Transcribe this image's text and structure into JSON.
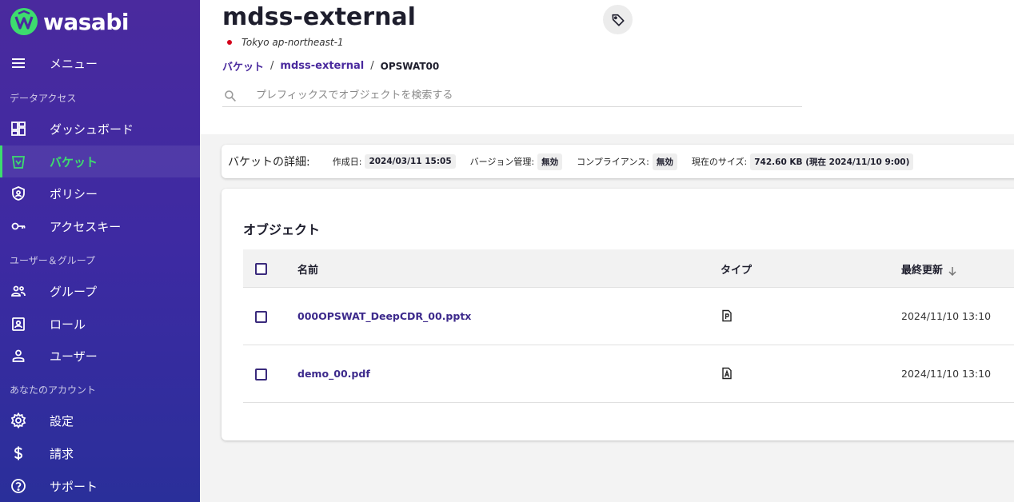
{
  "brand": {
    "name": "wasabi",
    "accent": "#3ddc6e",
    "sidebar_color": "#4a2a9e"
  },
  "sidebar": {
    "menu_label": "メニュー",
    "sections": [
      {
        "label": "データアクセス"
      },
      {
        "label": "ユーザー＆グループ"
      },
      {
        "label": "あなたのアカウント"
      }
    ],
    "items": [
      {
        "label": "ダッシュボード",
        "icon": "dashboard-icon"
      },
      {
        "label": "バケット",
        "icon": "bucket-icon",
        "active": true
      },
      {
        "label": "ポリシー",
        "icon": "policy-shield-icon"
      },
      {
        "label": "アクセスキー",
        "icon": "key-icon"
      },
      {
        "label": "グループ",
        "icon": "group-icon"
      },
      {
        "label": "ロール",
        "icon": "role-badge-icon"
      },
      {
        "label": "ユーザー",
        "icon": "user-icon"
      },
      {
        "label": "設定",
        "icon": "gear-icon"
      },
      {
        "label": "請求",
        "icon": "dollar-icon"
      },
      {
        "label": "サポート",
        "icon": "help-icon"
      }
    ]
  },
  "header": {
    "title": "mdss-external",
    "region": "Tokyo ap-northeast-1",
    "breadcrumb": {
      "root": "バケット",
      "bucket": "mdss-external",
      "current": "OPSWAT00",
      "separator": "/"
    },
    "search_placeholder": "プレフィックスでオブジェクトを検索する"
  },
  "details": {
    "title": "バケットの詳細:",
    "created_label": "作成日:",
    "created_value": "2024/03/11 15:05",
    "versioning_label": "バージョン管理:",
    "versioning_value": "無効",
    "compliance_label": "コンプライアンス:",
    "compliance_value": "無効",
    "size_label": "現在のサイズ:",
    "size_value": "742.60 KB (現在 2024/11/10 9:00)"
  },
  "objects": {
    "title": "オブジェクト",
    "columns": {
      "name": "名前",
      "type": "タイプ",
      "modified": "最終更新"
    },
    "rows": [
      {
        "name": "000OPSWAT_DeepCDR_00.pptx",
        "type_icon": "powerpoint-file-icon",
        "modified": "2024/11/10 13:10"
      },
      {
        "name": "demo_00.pdf",
        "type_icon": "pdf-file-icon",
        "modified": "2024/11/10 13:10"
      }
    ]
  }
}
